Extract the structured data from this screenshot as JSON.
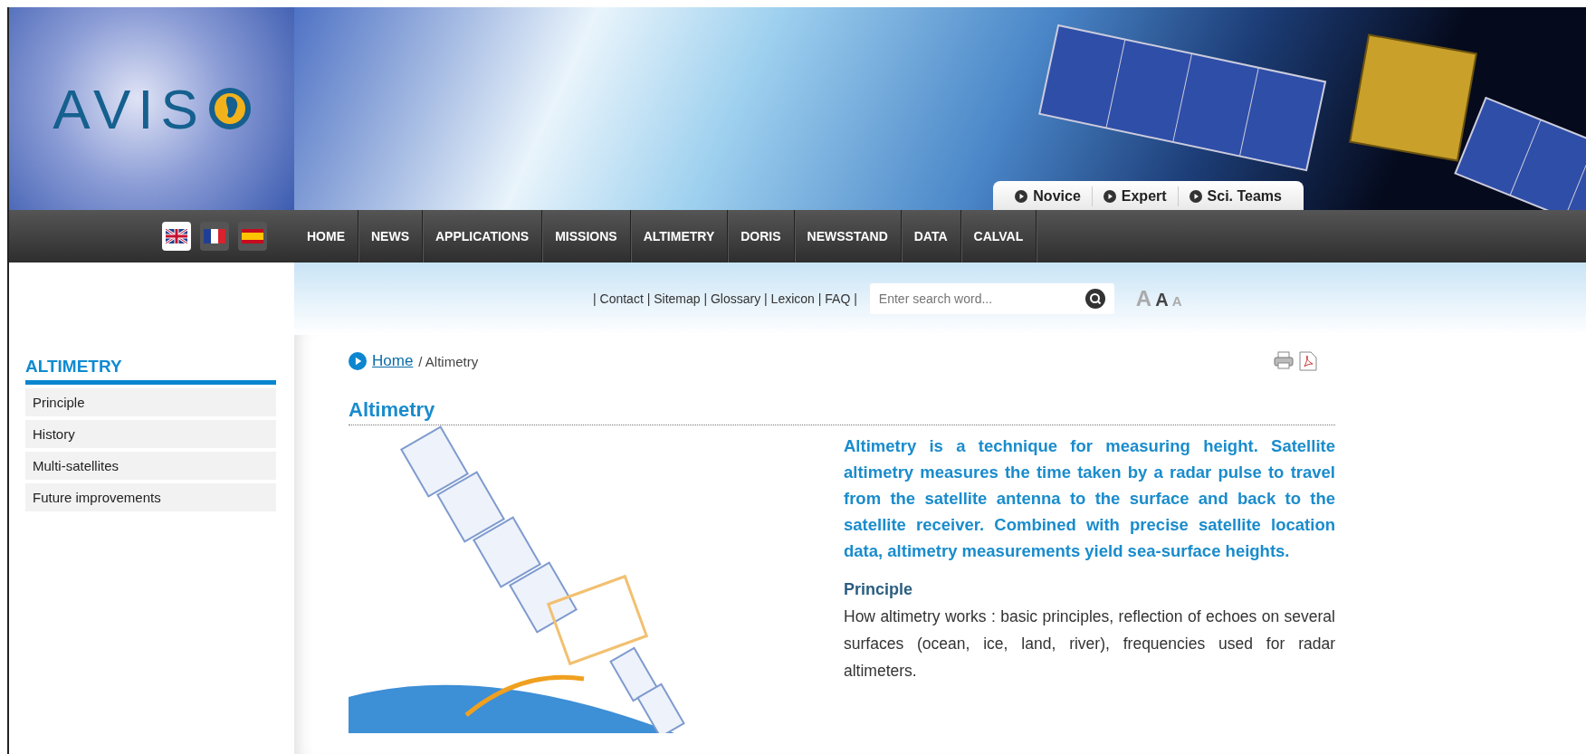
{
  "logo": {
    "text": "AVIS"
  },
  "levels": [
    {
      "label": "Novice"
    },
    {
      "label": "Expert"
    },
    {
      "label": "Sci. Teams"
    }
  ],
  "languages": [
    {
      "kind": "uk",
      "selected": true
    },
    {
      "kind": "fr",
      "selected": false
    },
    {
      "kind": "es",
      "selected": false
    }
  ],
  "nav": [
    {
      "label": "HOME"
    },
    {
      "label": "NEWS"
    },
    {
      "label": "APPLICATIONS"
    },
    {
      "label": "MISSIONS"
    },
    {
      "label": "ALTIMETRY"
    },
    {
      "label": "DORIS"
    },
    {
      "label": "NEWSSTAND"
    },
    {
      "label": "DATA"
    },
    {
      "label": "CALVAL"
    }
  ],
  "utility_links": {
    "separator": "|",
    "links": [
      "Contact",
      "Sitemap",
      "Glossary",
      "Lexicon",
      "FAQ"
    ]
  },
  "search": {
    "placeholder": "Enter search word..."
  },
  "font_sizes": [
    {
      "label": "A",
      "selected": false
    },
    {
      "label": "A",
      "selected": true
    },
    {
      "label": "A",
      "selected": false
    }
  ],
  "sidebar": {
    "title": "ALTIMETRY",
    "items": [
      "Principle",
      "History",
      "Multi-satellites",
      "Future improvements"
    ]
  },
  "breadcrumb": {
    "link": "Home",
    "current": "/ Altimetry"
  },
  "article": {
    "title": "Altimetry",
    "intro": "Altimetry is a technique for measuring height. Satellite altimetry measures the time taken by a radar pulse to travel from the satellite antenna to the surface and back to the satellite receiver. Combined with precise satellite location data, altimetry measurements yield sea-surface heights.",
    "sections": [
      {
        "heading": "Principle",
        "text": "How altimetry works : basic principles, reflection of echoes on several surfaces (ocean, ice, land, river), frequencies used for radar altimeters."
      }
    ]
  }
}
